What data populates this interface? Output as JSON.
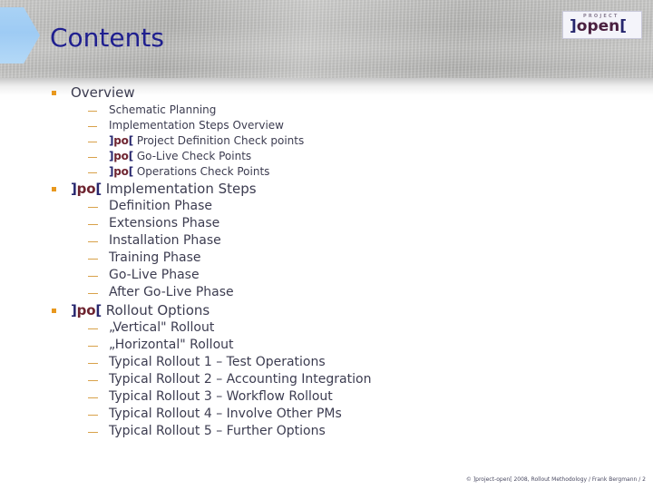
{
  "slide": {
    "title": "Contents",
    "logo": {
      "bracket_left": "]",
      "small_text": "PROJECT",
      "word": "open",
      "bracket_right": "[",
      "accent_blue": "#26266e",
      "accent_maroon": "#4a2040"
    },
    "footer": "© ]project-open[ 2008, Rollout Methodology / Frank Bergmann / 2",
    "colors": {
      "title": "#1f1f8f",
      "body_text": "#3c3c50",
      "bullet_square": "#e8981e",
      "bullet_dash": "#d8a14a",
      "hex_accent": "#9ecbf4",
      "header_band": "#aaaaa8"
    }
  },
  "sections": [
    {
      "heading": "Overview",
      "heading_has_po": false,
      "items": [
        {
          "po": false,
          "text": "Schematic Planning"
        },
        {
          "po": false,
          "text": "Implementation Steps Overview"
        },
        {
          "po": true,
          "text": "Project Definition Check points"
        },
        {
          "po": true,
          "text": "Go-Live Check Points"
        },
        {
          "po": true,
          "text": "Operations Check Points"
        }
      ]
    },
    {
      "heading": "Implementation Steps",
      "heading_has_po": true,
      "items": [
        {
          "po": false,
          "text": "Definition Phase"
        },
        {
          "po": false,
          "text": "Extensions Phase"
        },
        {
          "po": false,
          "text": "Installation Phase"
        },
        {
          "po": false,
          "text": "Training Phase"
        },
        {
          "po": false,
          "text": "Go-Live Phase"
        },
        {
          "po": false,
          "text": "After Go-Live Phase"
        }
      ]
    },
    {
      "heading": "Rollout Options",
      "heading_has_po": true,
      "items": [
        {
          "po": false,
          "text": "„Vertical\" Rollout"
        },
        {
          "po": false,
          "text": "„Horizontal\" Rollout"
        },
        {
          "po": false,
          "text": "Typical Rollout 1 – Test Operations"
        },
        {
          "po": false,
          "text": "Typical Rollout 2 – Accounting Integration"
        },
        {
          "po": false,
          "text": "Typical Rollout 3 – Workflow Rollout"
        },
        {
          "po": false,
          "text": "Typical Rollout 4 – Involve Other PMs"
        },
        {
          "po": false,
          "text": "Typical Rollout 5 – Further Options"
        }
      ]
    }
  ]
}
